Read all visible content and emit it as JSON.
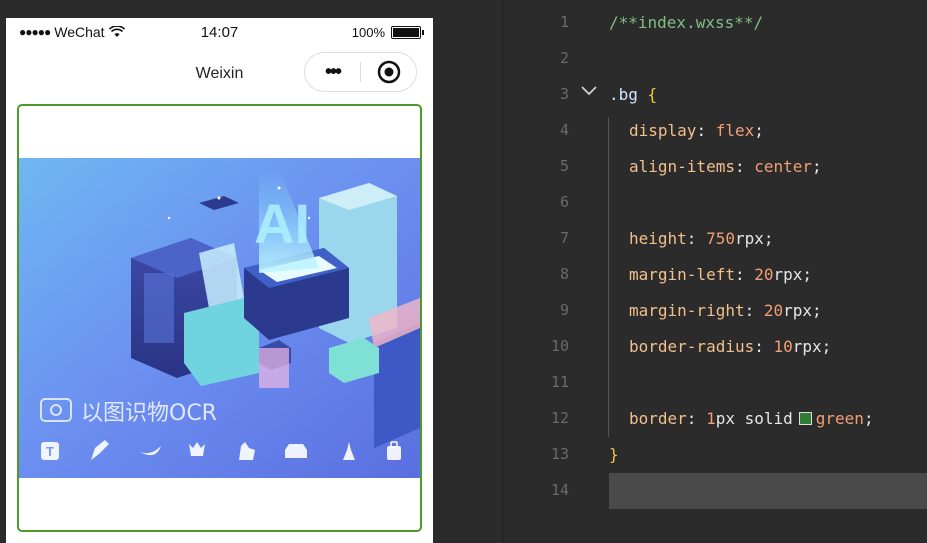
{
  "phone": {
    "carrier": "WeChat",
    "signal_dots": "●●●●●",
    "time": "14:07",
    "battery": "100%",
    "nav_title": "Weixin",
    "more_label": "•••"
  },
  "banner": {
    "brand_text": "以图识物OCR",
    "ai_text": "AI",
    "icons": [
      "text-icon",
      "pen-icon",
      "leaf-icon",
      "flower-icon",
      "animal-icon",
      "car-icon",
      "tower-icon",
      "bag-icon"
    ]
  },
  "editor": {
    "lines": [
      {
        "n": "1",
        "text": "/**index.wxss**/"
      },
      {
        "n": "2",
        "text": ""
      },
      {
        "n": "3",
        "sel": ".bg",
        "brace": " {"
      },
      {
        "n": "4",
        "prop": "display",
        "val": "flex"
      },
      {
        "n": "5",
        "prop": "align-items",
        "val": "center"
      },
      {
        "n": "6",
        "text": ""
      },
      {
        "n": "7",
        "prop": "height",
        "num": "750",
        "unit": "rpx"
      },
      {
        "n": "8",
        "prop": "margin-left",
        "num": "20",
        "unit": "rpx"
      },
      {
        "n": "9",
        "prop": "margin-right",
        "num": "20",
        "unit": "rpx"
      },
      {
        "n": "10",
        "prop": "border-radius",
        "num": "10",
        "unit": "rpx"
      },
      {
        "n": "11",
        "text": ""
      },
      {
        "n": "12",
        "prop": "border",
        "num": "1",
        "unit": "px",
        "extra": " solid",
        "color": "green"
      },
      {
        "n": "13",
        "close": "}"
      },
      {
        "n": "14",
        "text": ""
      }
    ]
  },
  "colors": {
    "border_green": "#4c9a2a",
    "editor_bg": "#2b2b2b"
  }
}
